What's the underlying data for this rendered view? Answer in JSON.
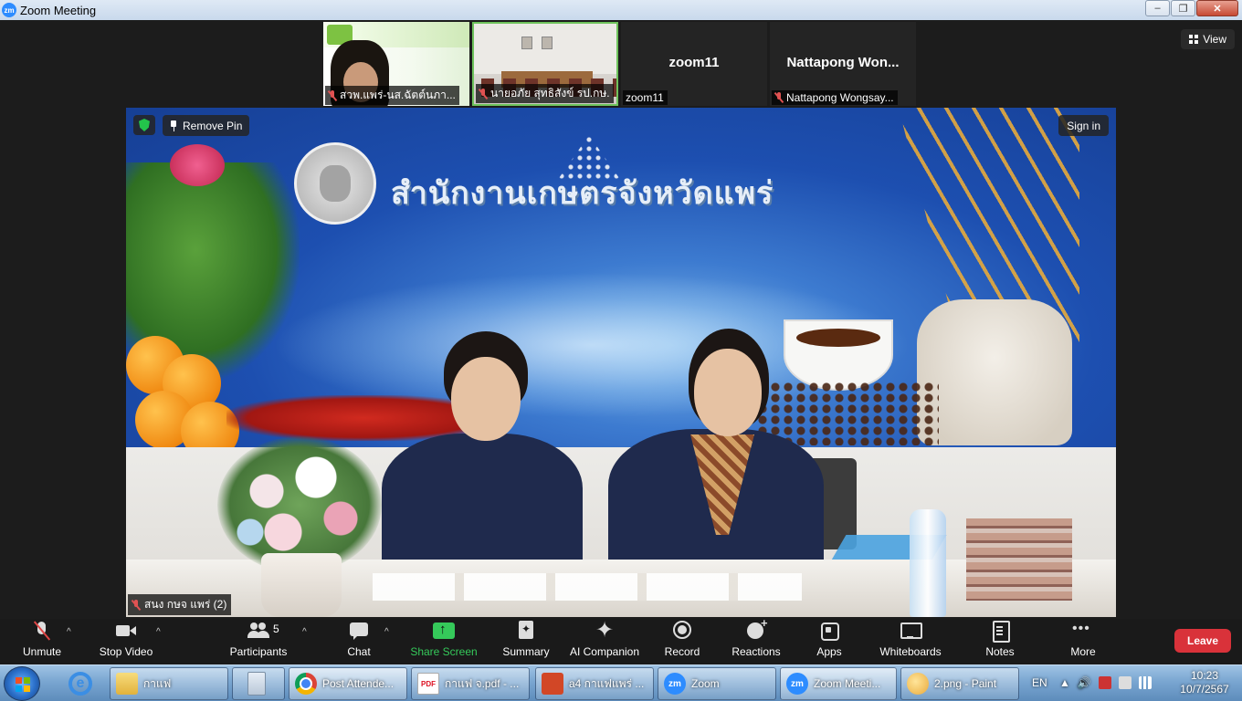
{
  "window": {
    "icon": "zm",
    "title": "Zoom Meeting",
    "controls": {
      "minimize": "–",
      "maximize": "❐",
      "close": "✕"
    }
  },
  "view_button": {
    "label": "View"
  },
  "thumbnails": [
    {
      "caption": "สวพ.แพร่-นส.ฉัตต์นภา...",
      "muted": true,
      "video": true
    },
    {
      "caption": "นายอภัย สุทธิสังข์ รป.กษ.",
      "muted": true,
      "video": true
    },
    {
      "name": "zoom11",
      "caption": "zoom11",
      "muted": false,
      "video": false
    },
    {
      "name": "Nattapong Won...",
      "caption": "Nattapong Wongsay...",
      "muted": true,
      "video": false
    }
  ],
  "main_video": {
    "remove_pin": "Remove Pin",
    "sign_in": "Sign in",
    "banner_text": "สำนักงานเกษตรจังหวัดแพร่",
    "caption": "สนง กษจ แพร่ (2)"
  },
  "toolbar": {
    "unmute": "Unmute",
    "stop_video": "Stop Video",
    "participants": "Participants",
    "participants_count": "5",
    "chat": "Chat",
    "share_screen": "Share Screen",
    "summary": "Summary",
    "ai_companion": "AI Companion",
    "record": "Record",
    "reactions": "Reactions",
    "apps": "Apps",
    "whiteboards": "Whiteboards",
    "notes": "Notes",
    "more": "More",
    "leave": "Leave",
    "caret": "^"
  },
  "taskbar": {
    "buttons": [
      {
        "label": "กาแฟ",
        "icon": "folder-icon"
      },
      {
        "label": "",
        "icon": "calculator-icon"
      },
      {
        "label": "Post Attende...",
        "icon": "chrome-icon"
      },
      {
        "label": "กาแฟ จ.pdf - ...",
        "icon": "pdf-icon"
      },
      {
        "label": "a4 กาแฟแพร่ ...",
        "icon": "powerpoint-icon"
      },
      {
        "label": "Zoom",
        "icon": "zoom-icon"
      },
      {
        "label": "Zoom Meeti...",
        "icon": "zoom-icon"
      },
      {
        "label": "2.png - Paint",
        "icon": "paint-icon"
      }
    ],
    "pdf_badge": "PDF",
    "zoom_badge": "zm",
    "ie_glyph": "e",
    "lang": "EN",
    "tray_arrow": "▲",
    "speaker_glyph": "🔊",
    "time": "10:23",
    "date": "10/7/2567"
  }
}
